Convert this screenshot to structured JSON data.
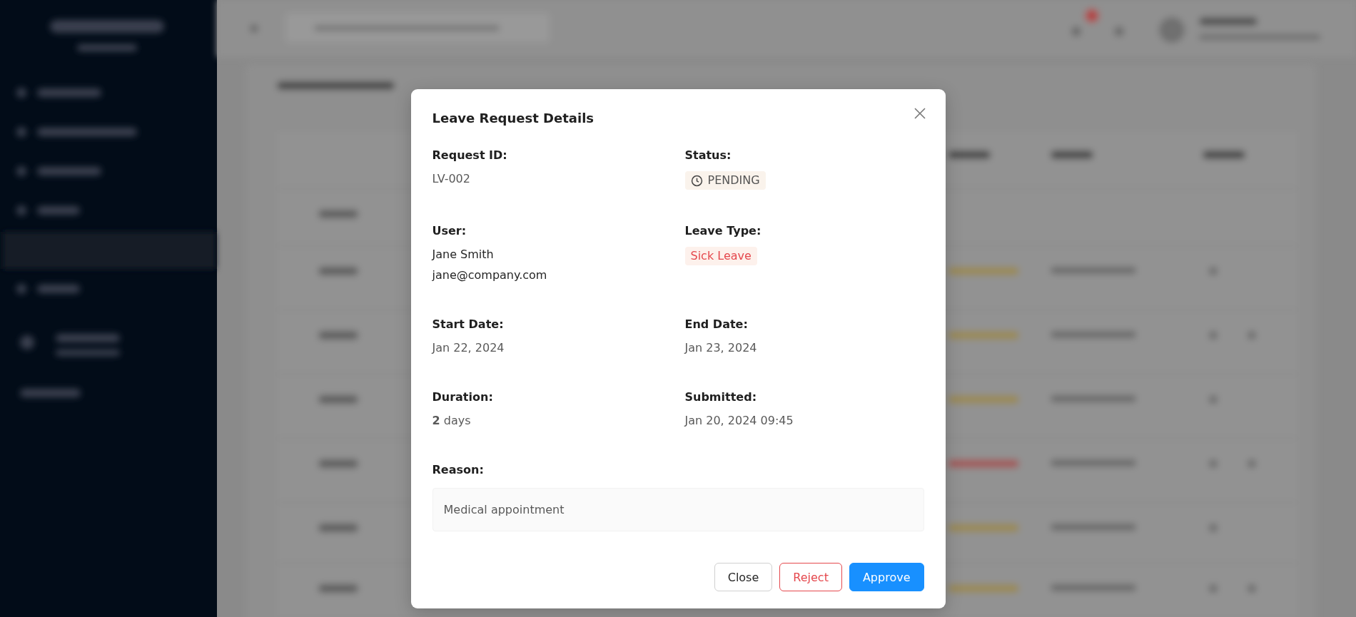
{
  "modal": {
    "title": "Leave Request Details",
    "fields": [
      {
        "kind": "text",
        "label": "Request ID:",
        "value": "LV-002"
      },
      {
        "kind": "status",
        "label": "Status:",
        "value": "PENDING"
      },
      {
        "kind": "user",
        "label": "User:",
        "value": "Jane Smith",
        "secondary": "jane@company.com"
      },
      {
        "kind": "tag",
        "label": "Leave Type:",
        "value": "Sick Leave"
      },
      {
        "kind": "text",
        "label": "Start Date:",
        "value": "Jan 22, 2024"
      },
      {
        "kind": "text",
        "label": "End Date:",
        "value": "Jan 23, 2024"
      },
      {
        "kind": "text",
        "label": "Duration:",
        "value": "**2** days"
      },
      {
        "kind": "text",
        "label": "Submitted:",
        "value": "Jan 20, 2024 09:45"
      }
    ],
    "reason": {
      "label": "Reason:",
      "value": "Medical appointment"
    },
    "buttons": [
      {
        "kind": "default",
        "label": "Close"
      },
      {
        "kind": "danger",
        "label": "Reject"
      },
      {
        "kind": "primary",
        "label": "Approve"
      }
    ]
  }
}
